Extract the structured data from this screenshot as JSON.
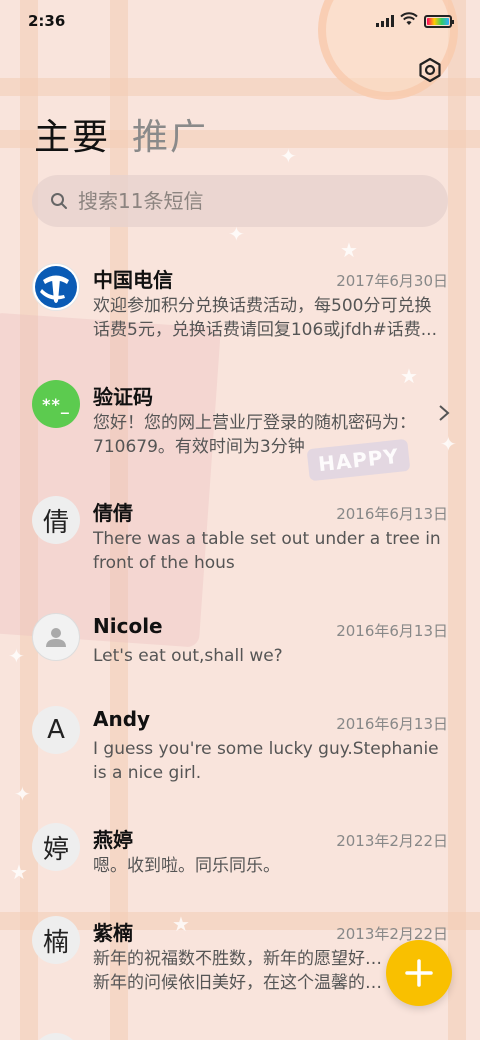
{
  "status_bar": {
    "time": "2:36"
  },
  "tabs": [
    {
      "label": "主要",
      "active": true
    },
    {
      "label": "推广",
      "active": false
    }
  ],
  "search": {
    "placeholder": "搜索11条短信"
  },
  "messages": [
    {
      "sender": "中国电信",
      "date": "2017年6月30日",
      "avatar_text": "",
      "avatar_type": "china-telecom-logo",
      "lines": [
        "欢迎参加积分兑换话费活动，每500分可兑换",
        "话费5元，兑换话费请回复106或jfdh#话费..."
      ]
    },
    {
      "sender": "验证码",
      "date": "",
      "avatar_text": "**_",
      "avatar_type": "verification-code",
      "lines": [
        "您好！您的网上营业厅登录的随机密码为：",
        "710679。有效时间为3分钟"
      ],
      "has_chevron": true
    },
    {
      "sender": "倩倩",
      "date": "2016年6月13日",
      "avatar_text": "倩",
      "avatar_type": "initial",
      "lines": [
        "There was a table set out under a tree in",
        "front of the hous"
      ]
    },
    {
      "sender": "Nicole",
      "date": "2016年6月13日",
      "avatar_text": "",
      "avatar_type": "person-icon",
      "lines": [
        "Let's eat out,shall we?"
      ]
    },
    {
      "sender": "Andy",
      "date": "2016年6月13日",
      "avatar_text": "A",
      "avatar_type": "initial",
      "lines": [
        "I guess you're some lucky guy.Stephanie",
        "is a nice girl."
      ]
    },
    {
      "sender": "燕婷",
      "date": "2013年2月22日",
      "avatar_text": "婷",
      "avatar_type": "initial",
      "lines": [
        "嗯。收到啦。同乐同乐。"
      ]
    },
    {
      "sender": "紫楠",
      "date": "2013年2月22日",
      "avatar_text": "楠",
      "avatar_type": "initial",
      "lines": [
        "新年的祝福数不胜数，新年的愿望好多好多，",
        "新年的问候依旧美好，在这个温馨的时刻..."
      ]
    }
  ],
  "background": {
    "tag_text": "HAPPY"
  },
  "colors": {
    "fab": "#f9c000",
    "verification_avatar": "#5ccb4f",
    "telecom_blue": "#0a5bb5"
  },
  "icons": {
    "settings": "settings-icon",
    "search": "search-icon",
    "fab": "plus-icon",
    "chevron": "chevron-right-icon"
  }
}
